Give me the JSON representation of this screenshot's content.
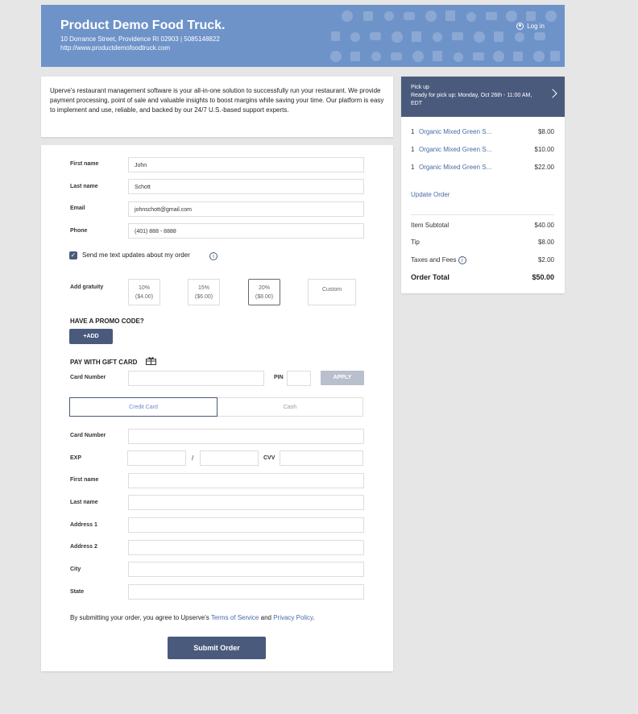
{
  "header": {
    "title": "Product Demo Food Truck.",
    "address": "10 Dorrance Street, Providence RI 02903 | 5085148822",
    "url": "http://www.productdemofoodtruck.com",
    "login_label": "Log in"
  },
  "intro": "Uperve's restaurant management software is your all-in-one solution to successfully run your restaurant. We provide payment processing, point of sale and valuable insights to boost margins while saving your time. Our platform is easy to implement and use, reliable, and backed by our 24/7 U.S.-based support experts.",
  "contact": {
    "first_name_label": "First name",
    "first_name_value": "John",
    "last_name_label": "Last name",
    "last_name_value": "Schott",
    "email_label": "Email",
    "email_value": "johnschott@gmail.com",
    "phone_label": "Phone",
    "phone_value": "(401) 888 - 8888",
    "sms_label": "Send me text updates about my order"
  },
  "gratuity": {
    "label": "Add gratuity",
    "options": [
      {
        "pct": "10%",
        "amount": "($4.00)"
      },
      {
        "pct": "15%",
        "amount": "($6.00)"
      },
      {
        "pct": "20%",
        "amount": "($8.00)"
      }
    ],
    "custom_label": "Custom"
  },
  "promo": {
    "heading": "HAVE A PROMO CODE?",
    "add_label": "+ADD"
  },
  "gift_card": {
    "heading": "PAY WITH GIFT CARD",
    "card_number_label": "Card Number",
    "pin_label": "PIN",
    "apply_label": "APPLY"
  },
  "payment": {
    "tab_credit": "Credit Card",
    "tab_cash": "Cash",
    "card_number_label": "Card Number",
    "exp_label": "EXP",
    "exp_separator": "/",
    "cvv_label": "CVV",
    "first_name_label": "First name",
    "last_name_label": "Last name",
    "address1_label": "Address 1",
    "address2_label": "Address 2",
    "city_label": "City",
    "state_label": "State"
  },
  "terms": {
    "prefix": "By submitting your order, you agree to Upserve's ",
    "tos": "Terms of Service",
    "and": " and ",
    "privacy": "Privacy Policy",
    "suffix": "."
  },
  "submit_label": "Submit Order",
  "order": {
    "pickup_title": "Pick up",
    "pickup_detail": "Ready for pick up: Monday, Oct 26th - 11:00 AM, EDT",
    "items": [
      {
        "qty": "1",
        "name": "Organic Mixed Green S...",
        "price": "$8.00"
      },
      {
        "qty": "1",
        "name": "Organic Mixed Green S...",
        "price": "$10.00"
      },
      {
        "qty": "1",
        "name": "Organic Mixed Green S...",
        "price": "$22.00"
      }
    ],
    "update_label": "Update Order",
    "subtotal_label": "Item Subtotal",
    "subtotal_value": "$40.00",
    "tip_label": "Tip",
    "tip_value": "$8.00",
    "taxes_label": "Taxes and Fees",
    "taxes_value": "$2.00",
    "total_label": "Order Total",
    "total_value": "$50.00"
  },
  "colors": {
    "header_bg": "#6e93c9",
    "primary": "#4a5a7c",
    "link": "#4a6aa8",
    "page_bg": "#e6e6e6"
  }
}
